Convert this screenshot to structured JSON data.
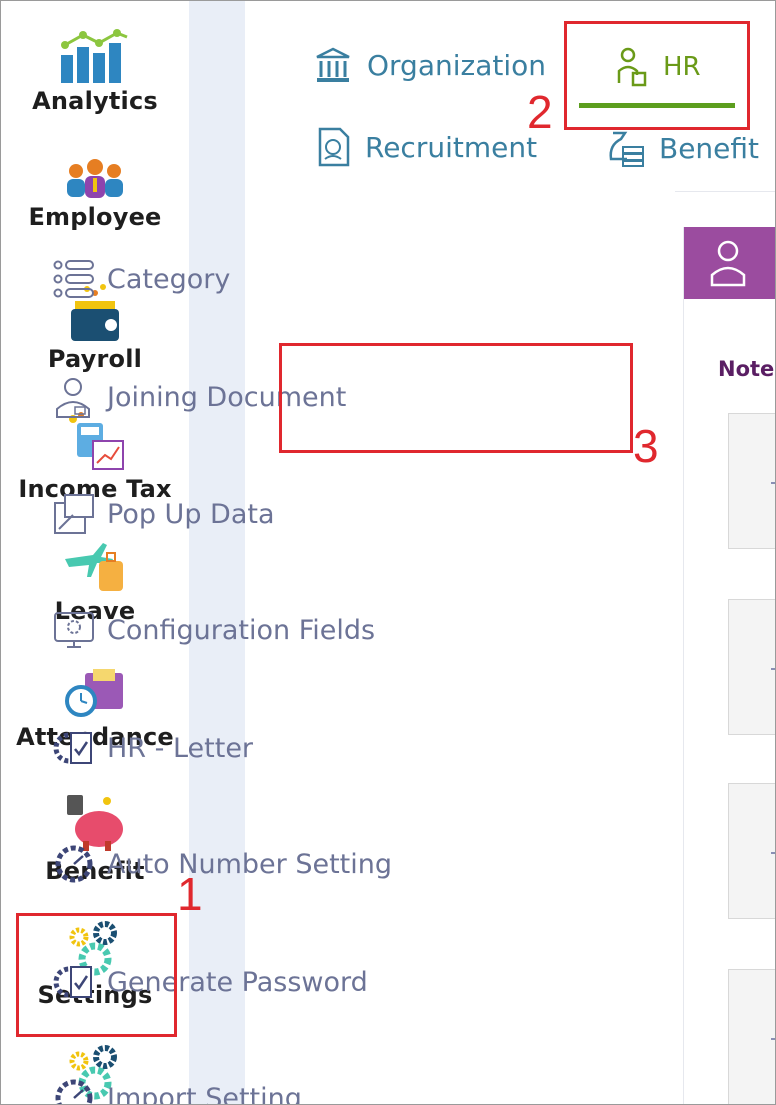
{
  "sidebar": {
    "items": [
      {
        "label": "Analytics"
      },
      {
        "label": "Employee"
      },
      {
        "label": "Payroll"
      },
      {
        "label": "Income Tax"
      },
      {
        "label": "Leave"
      },
      {
        "label": "Attendance"
      },
      {
        "label": "Benefit"
      },
      {
        "label": "Settings"
      }
    ]
  },
  "tabs": {
    "organization": "Organization",
    "hr": "HR",
    "recruitment": "Recruitment",
    "benefit": "Benefit"
  },
  "menu": {
    "items": [
      {
        "label": "Category"
      },
      {
        "label": "Joining Document"
      },
      {
        "label": "Pop Up Data"
      },
      {
        "label": "Configuration Fields"
      },
      {
        "label": "HR - Letter"
      },
      {
        "label": "Auto Number Setting"
      },
      {
        "label": "Generate Password"
      },
      {
        "label": "Import Setting"
      }
    ]
  },
  "panel": {
    "note": "Note"
  },
  "annotations": [
    "1",
    "2",
    "3"
  ],
  "colors": {
    "annotation": "#e0282e",
    "hr_active": "#5c9e1e",
    "panel_header": "#9b4c9f",
    "menu_text": "#6c7396",
    "tab_text": "#3a7fa0"
  }
}
